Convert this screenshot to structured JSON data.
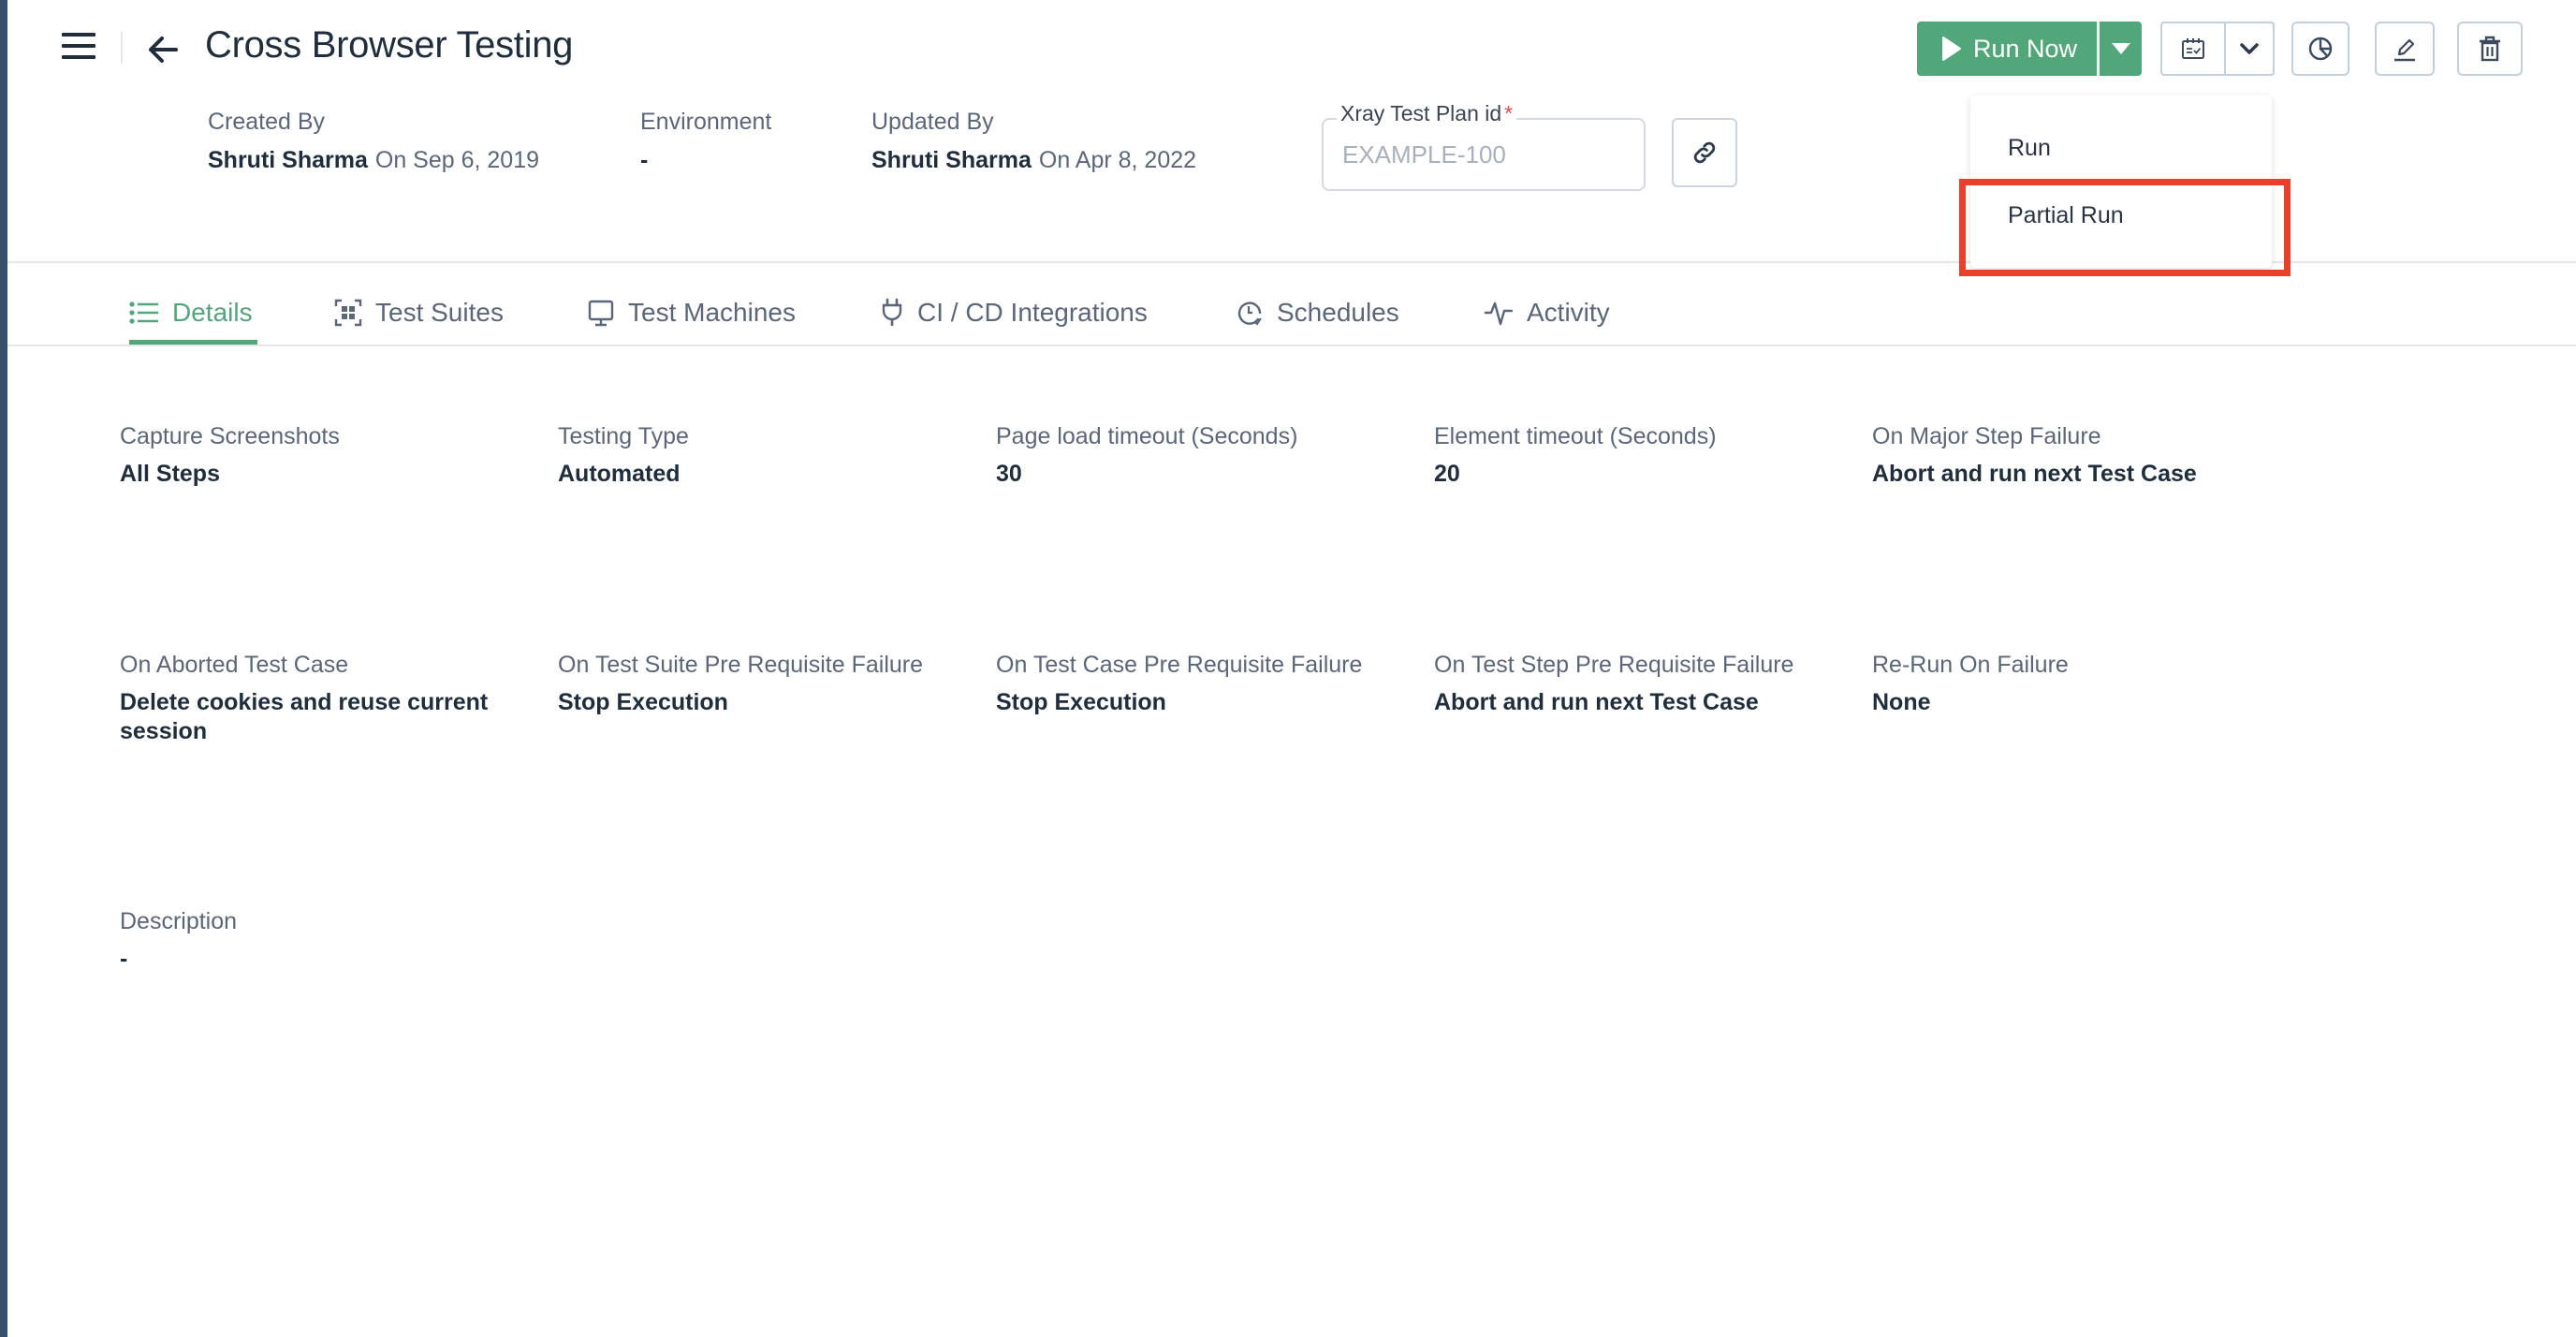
{
  "header": {
    "title": "Cross Browser Testing",
    "created_by": {
      "label": "Created By",
      "user": "Shruti Sharma",
      "date": "On Sep 6, 2019"
    },
    "environment": {
      "label": "Environment",
      "value": "-"
    },
    "updated_by": {
      "label": "Updated By",
      "user": "Shruti Sharma",
      "date": "On Apr 8, 2022"
    },
    "xray": {
      "label": "Xray Test Plan id",
      "required_mark": "*",
      "value": "",
      "placeholder": "EXAMPLE-100"
    }
  },
  "toolbar": {
    "run_now_label": "Run Now",
    "icons": [
      "play-icon",
      "caret-down-icon",
      "calendar-check-icon",
      "chevron-down-icon",
      "pie-chart-icon",
      "pencil-icon",
      "trash-icon",
      "link-icon"
    ]
  },
  "run_menu": {
    "items": [
      {
        "label": "Run"
      },
      {
        "label": "Partial Run",
        "highlighted": true
      }
    ]
  },
  "tabs": [
    {
      "label": "Details",
      "icon": "list-icon",
      "active": true
    },
    {
      "label": "Test Suites",
      "icon": "test-suites-icon",
      "active": false
    },
    {
      "label": "Test Machines",
      "icon": "monitor-icon",
      "active": false
    },
    {
      "label": "CI / CD Integrations",
      "icon": "plug-icon",
      "active": false
    },
    {
      "label": "Schedules",
      "icon": "clock-icon",
      "active": false
    },
    {
      "label": "Activity",
      "icon": "activity-icon",
      "active": false
    }
  ],
  "details": {
    "row1": [
      {
        "label": "Capture Screenshots",
        "value": "All Steps"
      },
      {
        "label": "Testing Type",
        "value": "Automated"
      },
      {
        "label": "Page load timeout (Seconds)",
        "value": "30"
      },
      {
        "label": "Element timeout (Seconds)",
        "value": "20"
      },
      {
        "label": "On Major Step Failure",
        "value": "Abort and run next Test Case"
      }
    ],
    "row2": [
      {
        "label": "On Aborted Test Case",
        "value": "Delete cookies and reuse current session"
      },
      {
        "label": "On Test Suite Pre Requisite Failure",
        "value": "Stop Execution"
      },
      {
        "label": "On Test Case Pre Requisite Failure",
        "value": "Stop Execution"
      },
      {
        "label": "On Test Step Pre Requisite Failure",
        "value": "Abort and run next Test Case"
      },
      {
        "label": "Re-Run On Failure",
        "value": "None"
      }
    ],
    "description": {
      "label": "Description",
      "value": "-"
    }
  },
  "colors": {
    "accent_green": "#51a67a",
    "sidebar_strip": "#34536a",
    "highlight_red": "#e8402b",
    "text_dark": "#1f2d3d",
    "text_muted": "#5b667a"
  }
}
